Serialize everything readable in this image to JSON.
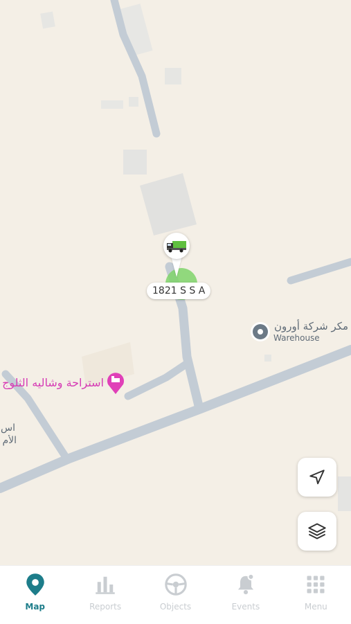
{
  "map": {
    "vehicle": {
      "label": "1821 S S A",
      "icon": "truck-icon"
    },
    "pois": [
      {
        "name": "مكر شركة أورون",
        "category": "Warehouse",
        "icon": "location-pin-icon"
      },
      {
        "name": "استراحة وشاليه الثلوج",
        "icon": "hotel-bed-icon"
      }
    ],
    "place_label": {
      "line1": "اس",
      "line2": "الأم"
    },
    "controls": {
      "locate_icon": "navigation-arrow-icon",
      "layers_icon": "layers-icon"
    }
  },
  "colors": {
    "accent": "#1d7d8a",
    "inactive": "#c9cdd1",
    "poi_pink": "#e040b8",
    "map_bg": "#f4efe6",
    "road": "#c3ccd5"
  },
  "tabbar": {
    "tabs": [
      {
        "label": "Map",
        "icon": "map-pin-icon",
        "active": true
      },
      {
        "label": "Reports",
        "icon": "bar-chart-icon",
        "active": false
      },
      {
        "label": "Objects",
        "icon": "steering-wheel-icon",
        "active": false
      },
      {
        "label": "Events",
        "icon": "bell-icon",
        "active": false
      },
      {
        "label": "Menu",
        "icon": "grid-icon",
        "active": false
      }
    ]
  }
}
